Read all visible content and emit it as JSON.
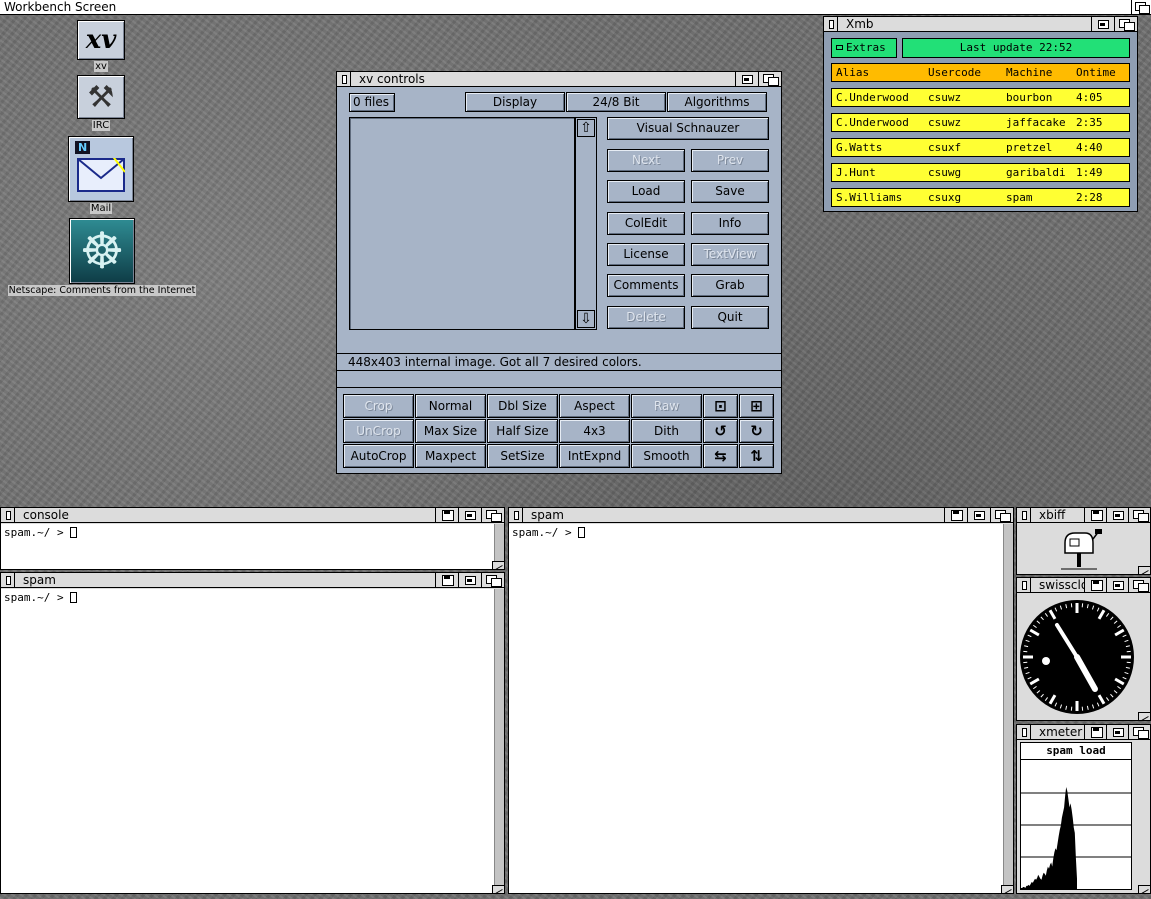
{
  "screen": {
    "title": "Workbench Screen"
  },
  "desktop_icons": [
    {
      "name": "xv",
      "label": "xv",
      "glyph": "xv"
    },
    {
      "name": "irc",
      "label": "IRC",
      "glyph": "⚒"
    },
    {
      "name": "mail",
      "label": "Mail",
      "glyph": "N"
    },
    {
      "name": "netscape",
      "label": "Netscape: Comments from the Internet",
      "glyph": "☸"
    }
  ],
  "xv_controls": {
    "title": "xv controls",
    "files_count": "0 files",
    "menu_buttons": [
      "Display",
      "24/8 Bit",
      "Algorithms"
    ],
    "visual_schnauzer": "Visual Schnauzer",
    "side_buttons": [
      {
        "label": "Next",
        "enabled": false
      },
      {
        "label": "Prev",
        "enabled": false
      },
      {
        "label": "Load",
        "enabled": true
      },
      {
        "label": "Save",
        "enabled": true
      },
      {
        "label": "ColEdit",
        "enabled": true
      },
      {
        "label": "Info",
        "enabled": true
      },
      {
        "label": "License",
        "enabled": true
      },
      {
        "label": "TextView",
        "enabled": false
      },
      {
        "label": "Comments",
        "enabled": true
      },
      {
        "label": "Grab",
        "enabled": true
      },
      {
        "label": "Delete",
        "enabled": false
      },
      {
        "label": "Quit",
        "enabled": true
      }
    ],
    "status": "448x403 internal image.  Got all 7 desired colors.",
    "status2": "",
    "bottom_buttons": [
      {
        "label": "Crop",
        "enabled": false
      },
      {
        "label": "Normal",
        "enabled": true
      },
      {
        "label": "Dbl Size",
        "enabled": true
      },
      {
        "label": "Aspect",
        "enabled": true
      },
      {
        "label": "Raw",
        "enabled": false
      },
      {
        "label": "UnCrop",
        "enabled": false
      },
      {
        "label": "Max Size",
        "enabled": true
      },
      {
        "label": "Half Size",
        "enabled": true
      },
      {
        "label": "4x3",
        "enabled": true
      },
      {
        "label": "Dith",
        "enabled": true
      },
      {
        "label": "AutoCrop",
        "enabled": true
      },
      {
        "label": "Maxpect",
        "enabled": true
      },
      {
        "label": "SetSize",
        "enabled": true
      },
      {
        "label": "IntExpnd",
        "enabled": true
      },
      {
        "label": "Smooth",
        "enabled": true
      }
    ],
    "icon_buttons": [
      "shrink-icon",
      "expand-icon",
      "rotate-left-icon",
      "rotate-right-icon",
      "flip-horizontal-icon",
      "flip-vertical-icon"
    ]
  },
  "xmb": {
    "title": "Xmb",
    "extras_label": "Extras",
    "last_update": "Last update 22:52",
    "headers": [
      "Alias",
      "Usercode",
      "Machine",
      "Ontime"
    ],
    "rows": [
      [
        "C.Underwood",
        "csuwz",
        "bourbon",
        "4:05"
      ],
      [
        "C.Underwood",
        "csuwz",
        "jaffacake",
        "2:35"
      ],
      [
        "G.Watts",
        "csuxf",
        "pretzel",
        "4:40"
      ],
      [
        "J.Hunt",
        "csuwg",
        "garibaldi",
        "1:49"
      ],
      [
        "S.Williams",
        "csuxg",
        "spam",
        "2:28"
      ]
    ],
    "colors": {
      "header": "#ffbb00",
      "row": "#ffff33",
      "status": "#22e077"
    }
  },
  "terminals": {
    "console": {
      "title": "console",
      "prompt": "spam.~/ > "
    },
    "spam_left": {
      "title": "spam",
      "prompt": "spam.~/ > "
    },
    "spam_center": {
      "title": "spam",
      "prompt": "spam.~/ > "
    }
  },
  "xbiff": {
    "title": "xbiff",
    "icon": "mailbox-icon"
  },
  "swissclock": {
    "title": "swissclock"
  },
  "xmeter": {
    "title": "xmeter",
    "graph_title": "spam load",
    "chart_data": {
      "type": "area",
      "title": "spam load",
      "values": [
        1,
        1,
        2,
        2,
        1,
        3,
        3,
        4,
        3,
        5,
        7,
        6,
        8,
        10,
        9,
        11,
        14,
        12,
        10,
        9,
        13,
        16,
        15,
        13,
        18,
        22,
        20,
        24,
        26,
        22,
        30,
        36,
        40,
        38,
        45,
        52,
        58,
        62,
        70,
        75,
        80,
        92,
        100,
        96,
        88,
        80,
        84,
        78,
        70,
        60,
        55,
        30,
        10
      ]
    }
  }
}
